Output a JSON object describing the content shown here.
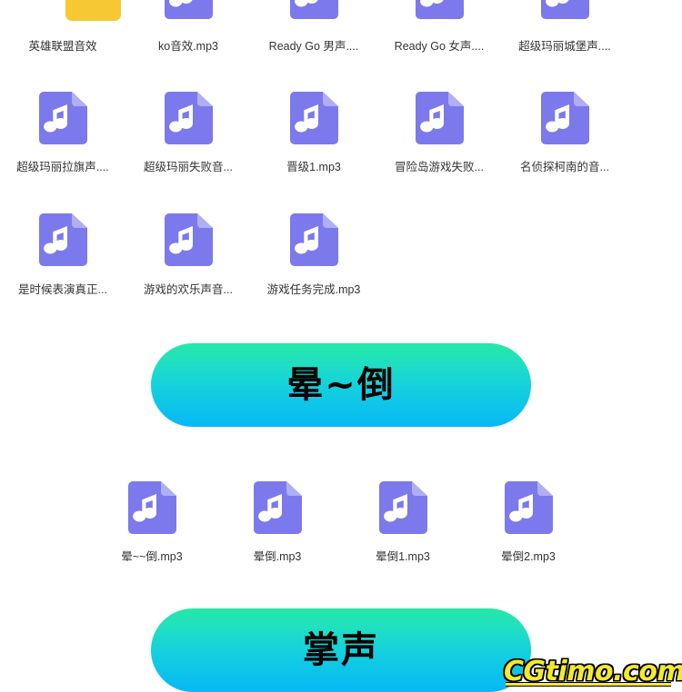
{
  "page": {
    "background_color": "#ffffff",
    "file_icon_color": "#7b79ec",
    "folder_icon_color": "#f6c833",
    "banner_gradient_start": "#25e8a5",
    "banner_gradient_end": "#06b8f5",
    "watermark_color": "#f2ea2a"
  },
  "grids": [
    {
      "id": "grid-row-1",
      "items": [
        {
          "label": "英雄联盟音效",
          "icon": "folder-icon"
        },
        {
          "label": "ko音效.mp3",
          "icon": "music-file-icon"
        },
        {
          "label": "Ready Go 男声....",
          "icon": "music-file-icon"
        },
        {
          "label": "Ready Go 女声....",
          "icon": "music-file-icon"
        },
        {
          "label": "超级玛丽城堡声....",
          "icon": "music-file-icon"
        }
      ]
    },
    {
      "id": "grid-row-2",
      "items": [
        {
          "label": "超级玛丽拉旗声....",
          "icon": "music-file-icon"
        },
        {
          "label": "超级玛丽失败音...",
          "icon": "music-file-icon"
        },
        {
          "label": "晋级1.mp3",
          "icon": "music-file-icon"
        },
        {
          "label": "冒险岛游戏失败...",
          "icon": "music-file-icon"
        },
        {
          "label": "名侦探柯南的音...",
          "icon": "music-file-icon"
        }
      ]
    },
    {
      "id": "grid-row-3",
      "items": [
        {
          "label": "是时候表演真正...",
          "icon": "music-file-icon"
        },
        {
          "label": "游戏的欢乐声音...",
          "icon": "music-file-icon"
        },
        {
          "label": "游戏任务完成.mp3",
          "icon": "music-file-icon"
        }
      ]
    },
    {
      "id": "grid-row-4",
      "items": [
        {
          "label": "晕~~倒.mp3",
          "icon": "music-file-icon"
        },
        {
          "label": "晕倒.mp3",
          "icon": "music-file-icon"
        },
        {
          "label": "晕倒1.mp3",
          "icon": "music-file-icon"
        },
        {
          "label": "晕倒2.mp3",
          "icon": "music-file-icon"
        }
      ]
    }
  ],
  "banners": [
    {
      "id": "banner-yundao",
      "text": "晕~倒"
    },
    {
      "id": "banner-zhangsheng",
      "text": "掌声"
    }
  ],
  "watermark": {
    "text": "CGtimo.com"
  }
}
